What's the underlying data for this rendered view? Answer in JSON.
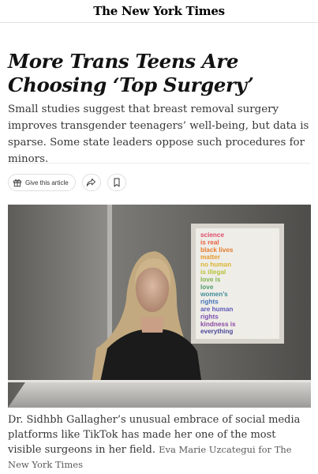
{
  "masthead": {
    "logo": "The New York Times"
  },
  "article": {
    "headline": "More Trans Teens Are Choosing ‘Top Surgery’",
    "summary": "Small studies suggest that breast removal surgery improves transgender teenagers’ well-being, but data is sparse. Some state leaders oppose such procedures for minors.",
    "actions": {
      "gift_label": "Give this article",
      "share_icon": "share-icon",
      "bookmark_icon": "bookmark-icon"
    },
    "poster_lines": [
      "science",
      "is real",
      "black lives",
      "matter",
      "no human",
      "is illegal",
      "love is",
      "love",
      "women’s",
      "rights",
      "are human",
      "rights",
      "kindness is",
      "everything"
    ],
    "caption": "Dr. Sidhbh Gallagher’s unusual embrace of social media platforms like TikTok has made her one of the most visible surgeons in her field.",
    "credit": "Eva Marie Uzcategui for The New York Times"
  },
  "colors": {
    "ink": "#121212",
    "summary": "#363636",
    "border": "#dfdfdf"
  }
}
